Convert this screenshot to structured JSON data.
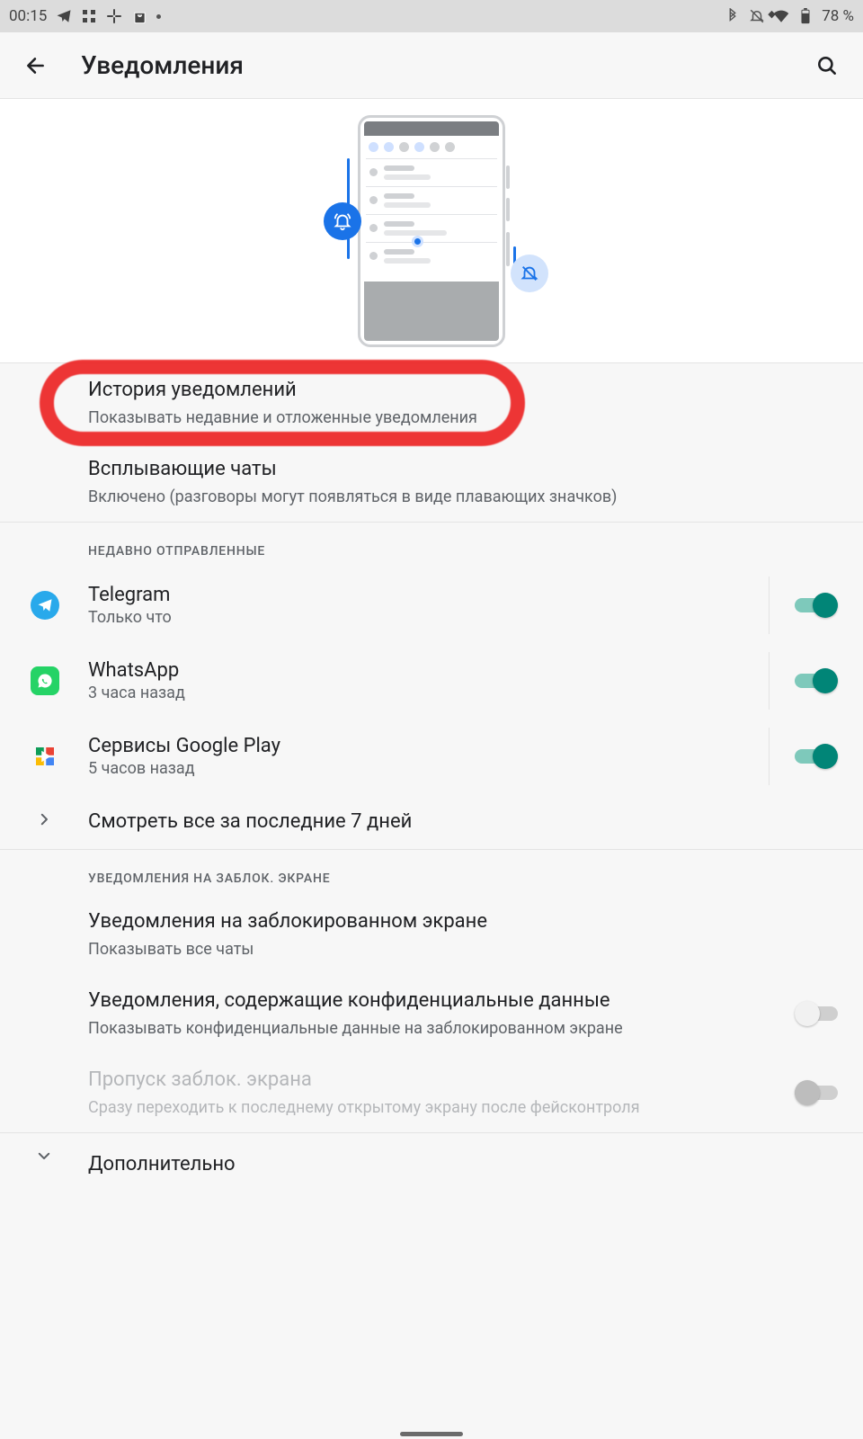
{
  "status": {
    "time": "00:15",
    "battery": "78 %"
  },
  "header": {
    "title": "Уведомления"
  },
  "top_items": [
    {
      "title": "История уведомлений",
      "subtitle": "Показывать недавние и отложенные уведомления"
    },
    {
      "title": "Всплывающие чаты",
      "subtitle": "Включено (разговоры могут появляться в виде плавающих значков)"
    }
  ],
  "recent": {
    "heading": "НЕДАВНО ОТПРАВЛЕННЫЕ",
    "apps": [
      {
        "name": "Telegram",
        "when": "Только что",
        "toggle": true,
        "icon": "telegram"
      },
      {
        "name": "WhatsApp",
        "when": "3 часа назад",
        "toggle": true,
        "icon": "whatsapp"
      },
      {
        "name": "Сервисы Google Play",
        "when": "5 часов назад",
        "toggle": true,
        "icon": "play"
      }
    ],
    "see_all": "Смотреть все за последние 7 дней"
  },
  "lock": {
    "heading": "УВЕДОМЛЕНИЯ НА ЗАБЛОК. ЭКРАНЕ",
    "items": [
      {
        "title": "Уведомления на заблокированном экране",
        "subtitle": "Показывать все чаты",
        "toggle": null
      },
      {
        "title": "Уведомления, содержащие конфиденциальные данные",
        "subtitle": "Показывать конфиденциальные данные на заблокированном экране",
        "toggle": false
      },
      {
        "title": "Пропуск заблок. экрана",
        "subtitle": "Сразу переходить к последнему открытому экрану после фейсконтроля",
        "toggle": false,
        "disabled": true
      }
    ]
  },
  "advanced": {
    "title": "Дополнительно"
  }
}
